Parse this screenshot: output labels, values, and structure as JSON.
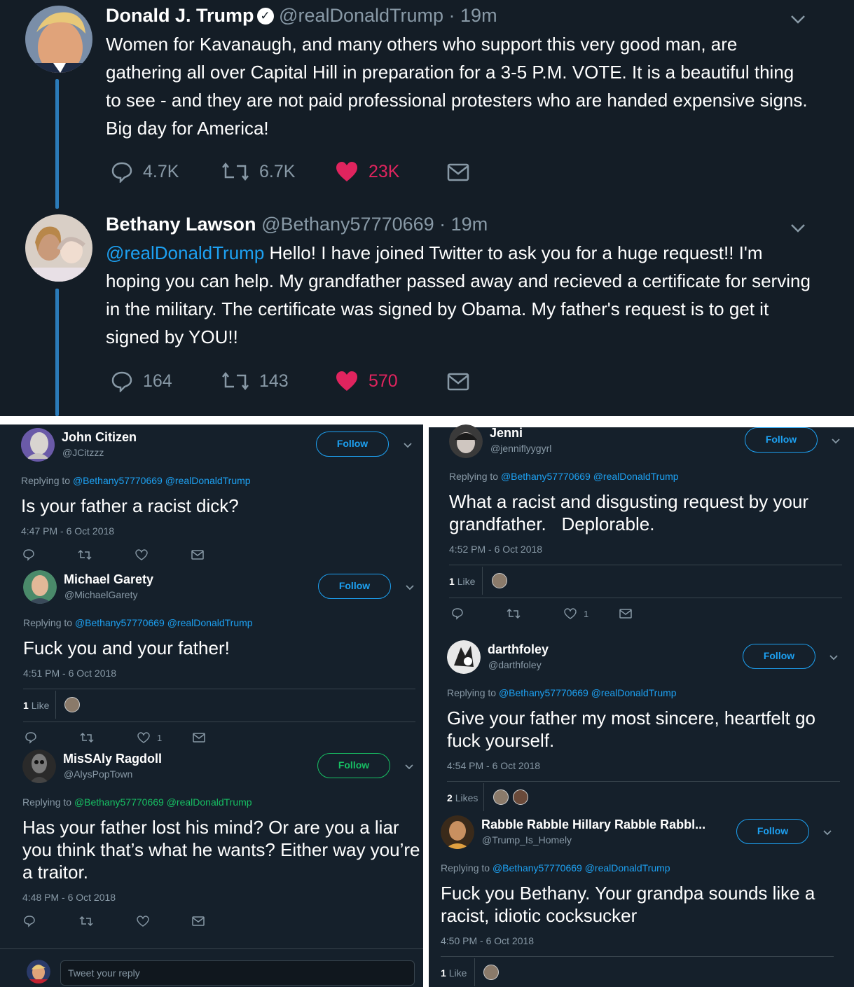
{
  "main_tweet": {
    "name": "Donald J. Trump",
    "handle_time": "@realDonaldTrump · 19m",
    "text": "Women for Kavanaugh, and many others who support this very good man, are gathering all over Capital Hill in preparation for a 3-5 P.M. VOTE. It is a beautiful thing to see - and they are not paid professional protesters who are handed expensive signs. Big day for America!",
    "replies": "4.7K",
    "retweets": "6.7K",
    "likes": "23K"
  },
  "reply_tweet": {
    "name": "Bethany Lawson",
    "handle_time": "@Bethany57770669 · 19m",
    "mention": "@realDonaldTrump",
    "text": " Hello! I have joined Twitter to ask you for a huge request!! I'm hoping you can help. My grandfather passed away and recieved a certificate for serving in the military. The certificate was signed by Obama. My father's request is to get it signed by YOU!!",
    "replies": "164",
    "retweets": "143",
    "likes": "570"
  },
  "replying_prefix": "Replying to ",
  "replying_mentions": "@Bethany57770669 @realDonaldTrump",
  "follow_label": "Follow",
  "composer_placeholder": "Tweet your reply",
  "left_replies": [
    {
      "name": "John Citizen",
      "handle": "@JCitzzz",
      "text": "Is your father a racist dick?",
      "time": "4:47 PM - 6 Oct 2018"
    },
    {
      "name": "Michael Garety",
      "handle": "@MichaelGarety",
      "text": "Fuck you and your father!",
      "time": "4:51 PM - 6 Oct 2018",
      "likes_count": "1",
      "likes_word": "Like",
      "like_action_count": "1"
    },
    {
      "name": "MisSAly Ragdoll",
      "handle": "@AlysPopTown",
      "text": "Has your father lost his mind? Or are you a liar you think that’s what he wants? Either way you’re a traitor.",
      "time": "4:48 PM - 6 Oct 2018"
    }
  ],
  "right_replies": [
    {
      "name": "Jenni",
      "handle": "@jenniflyygyrl",
      "text": "What a racist and disgusting request by your grandfather.   Deplorable.",
      "time": "4:52 PM - 6 Oct 2018",
      "likes_count": "1",
      "likes_word": "Like",
      "like_action_count": "1"
    },
    {
      "name": "darthfoley",
      "handle": "@darthfoley",
      "text": "Give your father my most sincere, heartfelt go fuck yourself.",
      "time": "4:54 PM - 6 Oct 2018",
      "likes_count": "2",
      "likes_word": "Likes"
    },
    {
      "name": "Rabble Rabble Hillary Rabble Rabbl...",
      "handle": "@Trump_Is_Homely",
      "text": "Fuck you Bethany. Your grandpa sounds like a racist, idiotic cocksucker",
      "time": "4:50 PM - 6 Oct 2018",
      "likes_count": "1",
      "likes_word": "Like"
    }
  ],
  "colors": {
    "background": "#141d26",
    "accent": "#1da1f2",
    "like": "#e0245e",
    "muted": "#8899a6"
  }
}
